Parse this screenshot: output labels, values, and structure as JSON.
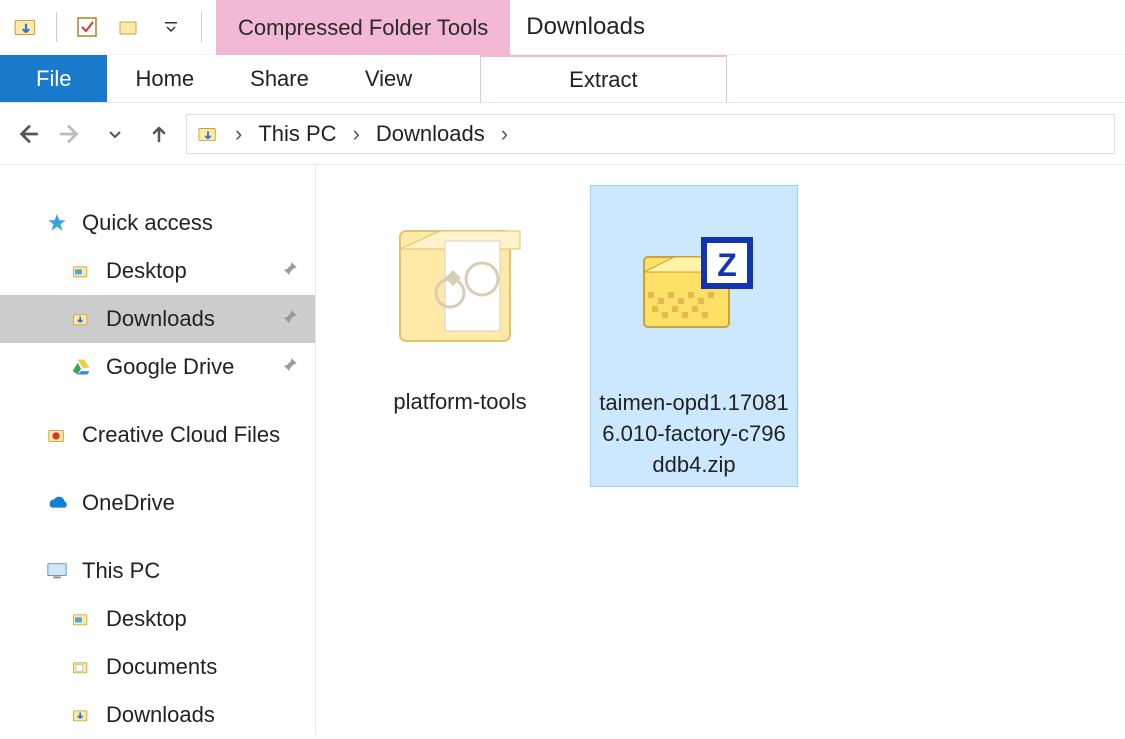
{
  "window": {
    "title": "Downloads"
  },
  "context_tab": {
    "group_label": "Compressed Folder Tools",
    "tab_label": "Extract"
  },
  "ribbon": {
    "file": "File",
    "home": "Home",
    "share": "Share",
    "view": "View"
  },
  "breadcrumb": {
    "root": "This PC",
    "current": "Downloads"
  },
  "sidebar": {
    "quick_access": "Quick access",
    "qa_items": {
      "desktop": "Desktop",
      "downloads": "Downloads",
      "google_drive": "Google Drive"
    },
    "creative_cloud": "Creative Cloud Files",
    "onedrive": "OneDrive",
    "this_pc": "This PC",
    "pc_items": {
      "desktop": "Desktop",
      "documents": "Documents",
      "downloads": "Downloads"
    }
  },
  "files": {
    "item1": "platform-tools",
    "item2": "taimen-opd1.170816.010-factory-c796ddb4.zip"
  }
}
